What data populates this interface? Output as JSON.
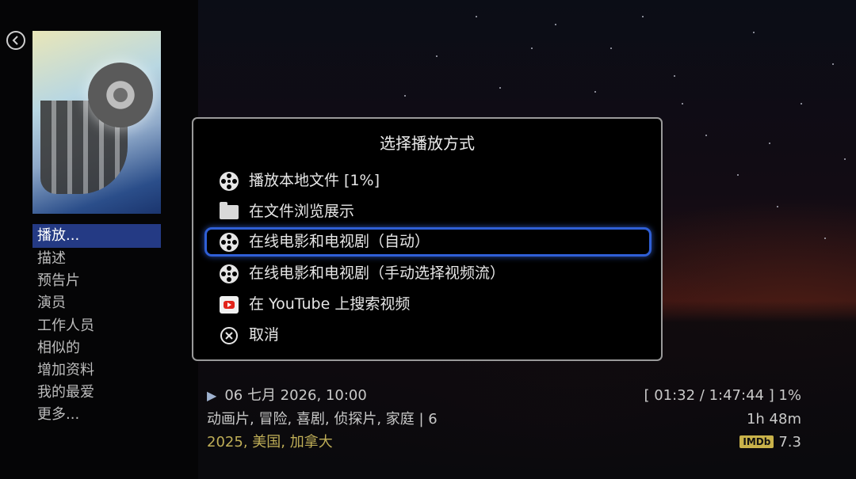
{
  "left_menu": {
    "items": [
      "播放...",
      "描述",
      "预告片",
      "演员",
      "工作人员",
      "相似的",
      "增加资料",
      "我的最爱",
      "更多..."
    ],
    "active_index": 0
  },
  "dialog": {
    "title": "选择播放方式",
    "options": [
      {
        "label": "播放本地文件  [1%]",
        "icon": "film-reel-icon"
      },
      {
        "label": "在文件浏览展示",
        "icon": "folder-icon"
      },
      {
        "label": "在线电影和电视剧（自动）",
        "icon": "film-reel-icon",
        "focused": true
      },
      {
        "label": "在线电影和电视剧（手动选择视频流）",
        "icon": "film-reel-icon"
      },
      {
        "label": "在 YouTube 上搜索视频",
        "icon": "youtube-icon"
      },
      {
        "label": "取消",
        "icon": "cancel-icon"
      }
    ]
  },
  "info": {
    "datetime": "06 七月 2026, 10:00",
    "progress": "[ 01:32 / 1:47:44 ]  1%",
    "genres": "动画片, 冒险, 喜剧, 侦探片, 家庭 | 6",
    "duration": "1h 48m",
    "year": "2025",
    "countries": ", 美国, 加拿大",
    "imdb_label": "IMDb",
    "imdb_rating": "7.3"
  },
  "colors": {
    "focus_border": "#2f5fd6",
    "menu_active_bg": "#243a84",
    "meta_gold": "#bfae57"
  }
}
